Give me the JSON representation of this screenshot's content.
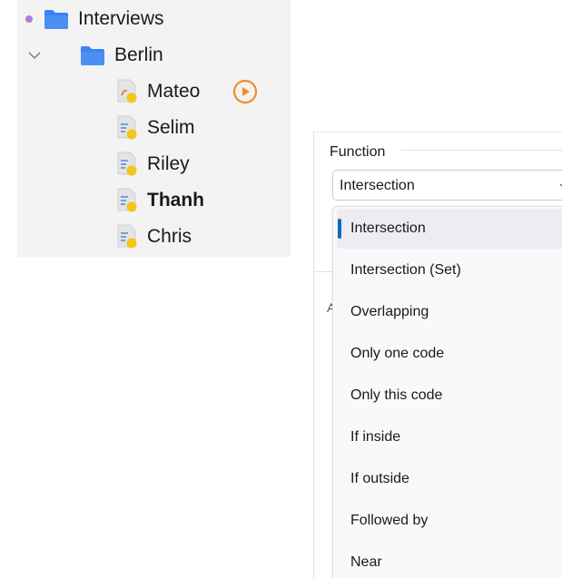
{
  "tree": {
    "root": {
      "label": "Interviews"
    },
    "folder": {
      "label": "Berlin"
    },
    "documents": [
      {
        "label": "Mateo",
        "bold": false,
        "kind": "media",
        "has_play": true
      },
      {
        "label": "Selim",
        "bold": false,
        "kind": "text"
      },
      {
        "label": "Riley",
        "bold": false,
        "kind": "text"
      },
      {
        "label": "Thanh",
        "bold": true,
        "kind": "text"
      },
      {
        "label": "Chris",
        "bold": false,
        "kind": "text"
      }
    ],
    "icons": {
      "root_dot": "memo-dot-icon",
      "folder": "folder-icon",
      "chevron": "chevron-down-icon",
      "text_doc": "text-document-icon",
      "media_doc": "media-document-icon",
      "play": "play-circle-icon"
    },
    "colors": {
      "folder": "#3b82f6",
      "dot": "#a37ee0",
      "play": "#f28c28",
      "doc_badge": "#f5c518"
    }
  },
  "function_panel": {
    "label": "Function",
    "selected_value": "Intersection",
    "background_letter": "A",
    "options": [
      "Intersection",
      "Intersection (Set)",
      "Overlapping",
      "Only one code",
      "Only this code",
      "If inside",
      "If outside",
      "Followed by",
      "Near"
    ],
    "selected_index": 0,
    "colors": {
      "accent": "#0f6cbd"
    }
  }
}
